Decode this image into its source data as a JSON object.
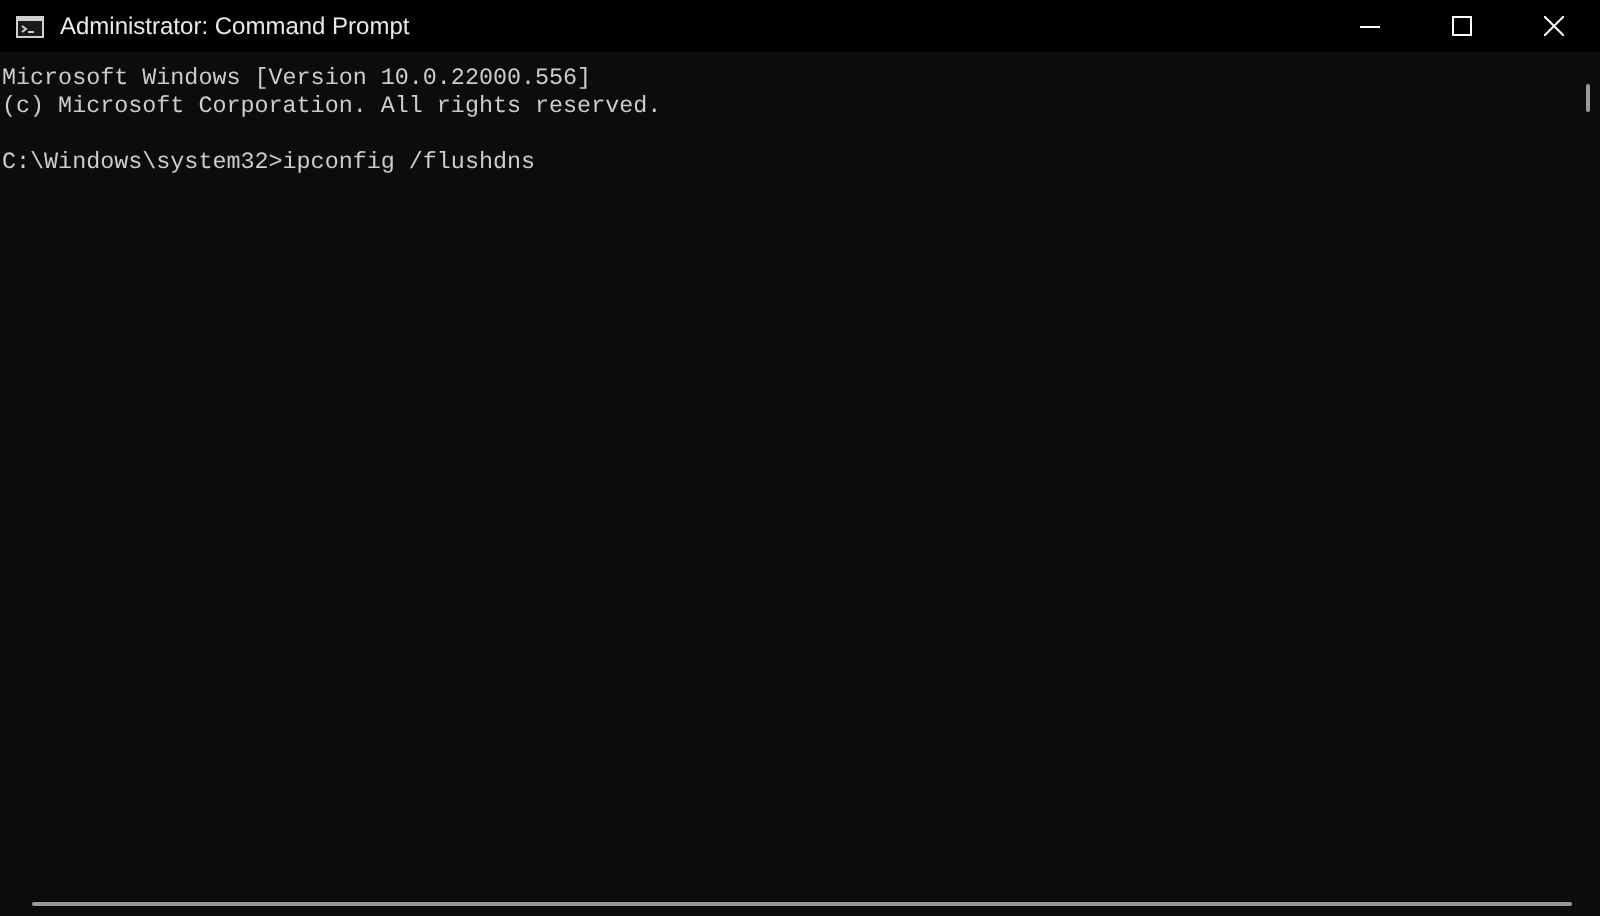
{
  "window": {
    "title": "Administrator: Command Prompt"
  },
  "console": {
    "output": [
      "Microsoft Windows [Version 10.0.22000.556]",
      "(c) Microsoft Corporation. All rights reserved."
    ],
    "command_line": "C:\\Windows\\system32>ipconfig /flushdns"
  }
}
